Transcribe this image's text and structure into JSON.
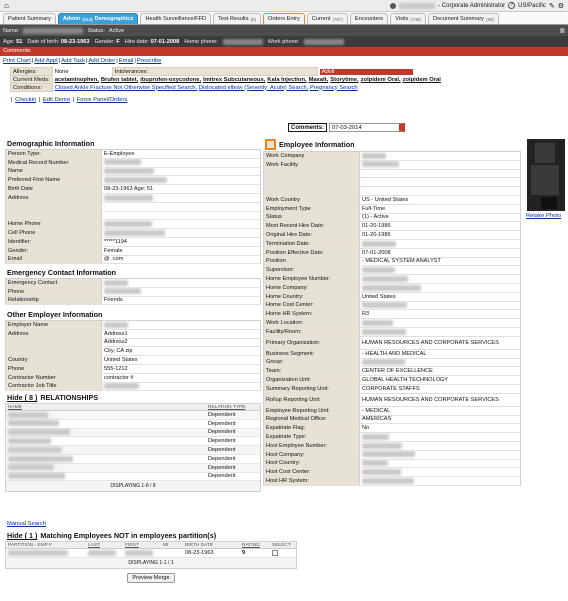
{
  "topbar": {
    "home_icon": "home-icon",
    "user_role": "- Corporate Administrator",
    "help_icon": "help-icon",
    "timezone": "US/Pacific",
    "edit_icon": "pencil-icon",
    "settings_icon": "gear-icon"
  },
  "tabs": [
    {
      "label": "Patient Summary",
      "count": ""
    },
    {
      "label": "Admin",
      "count": "(113)",
      "suffix": "Demographics"
    },
    {
      "label": "Health Surveillance/FFD",
      "count": ""
    },
    {
      "label": "Test Results",
      "count": "(6)"
    },
    {
      "label": "Orders Entry",
      "count": ""
    },
    {
      "label": "Current",
      "count": "(787)"
    },
    {
      "label": "Encounters",
      "count": ""
    },
    {
      "label": "Visits",
      "count": "(748)"
    },
    {
      "label": "Document Summary",
      "count": "(89)"
    }
  ],
  "patient": {
    "name_label": "Name:",
    "status_label": "Status:",
    "status": "Active",
    "age_label": "Age:",
    "age": "51",
    "dob_label": "Date of birth:",
    "dob": "08-23-1963",
    "gender_label": "Gender:",
    "gender": "F",
    "hire_label": "Hire date:",
    "hire_date": "07-01-2008",
    "home_phone_label": "Home phone:",
    "work_phone_label": "Work phone:"
  },
  "comments_bar": "Comments:",
  "actions": [
    "Print Chart",
    "Add Appt",
    "Add Task",
    "Add Order",
    "Email",
    "Prescribe"
  ],
  "clinical": {
    "allergies_label": "Allergies:",
    "allergies_value": "None",
    "intolerances_label": "Intolerances:",
    "intolerance_value": "Advil",
    "meds_label": "Current Meds:",
    "meds": [
      "acetaminophen,",
      "Brufen tablet,",
      "ibuprofen-oxycodone,",
      "Imitrex Subcutaneous,",
      "Kala Injection,",
      "Maxalt,",
      "Storytime,",
      "zolpidem Oral,",
      "zolpidem Oral"
    ],
    "conditions_label": "Conditions:",
    "conditions": [
      "Closed Ankle Fracture Not Otherwise Specified Search,",
      "Dislocated elbow (Severity: Acute) Search,",
      "Pregnancy Search"
    ]
  },
  "links2": [
    "Checkin",
    "Edit Demo",
    "Force Panel/Orders"
  ],
  "comments_box": {
    "label": "Comments:",
    "value": "07-03-2014"
  },
  "demographic": {
    "title": "Demographic Information",
    "rows": [
      {
        "k": "Person Type:",
        "v": "E-Employee"
      },
      {
        "k": "Medical Record Number",
        "v": ""
      },
      {
        "k": "Name",
        "v": ""
      },
      {
        "k": "Preferred First Name",
        "v": ""
      },
      {
        "k": "Birth Date",
        "v": "08-23-1963 Age: 51"
      },
      {
        "k": "Address",
        "v": ""
      },
      {
        "k": "",
        "v": ""
      },
      {
        "k": "",
        "v": ""
      },
      {
        "k": "Home Phone",
        "v": ""
      },
      {
        "k": "Cell Phone",
        "v": ""
      },
      {
        "k": "Identifier:",
        "v": "*****1194"
      },
      {
        "k": "Gender:",
        "v": "Female"
      },
      {
        "k": "Email",
        "v": "@ .com"
      }
    ]
  },
  "emergency": {
    "title": "Emergency Contact Information",
    "rows": [
      {
        "k": "Emergency Contact",
        "v": ""
      },
      {
        "k": "Phone",
        "v": ""
      },
      {
        "k": "Relationship",
        "v": "Friends"
      }
    ]
  },
  "other_employer": {
    "title": "Other Employer Information",
    "rows": [
      {
        "k": "Employer Name",
        "v": ""
      },
      {
        "k": "Address",
        "v": "Address1"
      },
      {
        "k": "",
        "v": "Address2"
      },
      {
        "k": "",
        "v": "City, CA zip"
      },
      {
        "k": "Country",
        "v": "United States"
      },
      {
        "k": "Phone",
        "v": "555-1212"
      },
      {
        "k": "Contractor Number",
        "v": "contractor #"
      },
      {
        "k": "Contractor Job Title",
        "v": ""
      }
    ]
  },
  "relationships": {
    "hide_label": "Hide ( 8 )",
    "title": "RELATIONSHIPS",
    "col_name": "NAME",
    "col_type": "RELATION TYPE",
    "rows": [
      "Dependent",
      "Dependent",
      "Dependent",
      "Dependent",
      "Dependent",
      "Dependent",
      "Dependent",
      "Dependent"
    ],
    "footer": "DISPLAYING 1-8 / 8"
  },
  "manual_search": "Manual Search",
  "matching": {
    "hide_label": "Hide ( 1 )",
    "title": "Matching Employees NOT in employees partition(s)",
    "cols": [
      "PARTITION - EMP #",
      "LAST",
      "FIRST",
      "MI",
      "BIRTH DATE",
      "RATING",
      "SELECT"
    ],
    "row": {
      "birth": "08-23-1963",
      "rating": "9"
    },
    "footer": "DISPLAYING 1-1 / 1",
    "preview_button": "Preview Merge"
  },
  "employee": {
    "title": "Employee Information",
    "rows": [
      {
        "k": "Work Company",
        "v": ""
      },
      {
        "k": "Work Facility",
        "v": ""
      },
      {
        "k": "",
        "v": ""
      },
      {
        "k": "",
        "v": ""
      },
      {
        "k": "",
        "v": ""
      },
      {
        "k": "Work Country",
        "v": "US - United States"
      },
      {
        "k": "Employment Type",
        "v": "Full-Time"
      },
      {
        "k": "Status",
        "v": "(1) - Active"
      },
      {
        "k": "Most Recent Hire Date:",
        "v": "01-20-1986"
      },
      {
        "k": "Original Hire Date:",
        "v": "01-20-1986"
      },
      {
        "k": "Termination Date:",
        "v": ""
      },
      {
        "k": "Position Effective Date:",
        "v": "07-01-2008"
      },
      {
        "k": "Position",
        "v": "- MEDICAL SYSTEM ANALYST"
      },
      {
        "k": "Supervisor:",
        "v": ""
      },
      {
        "k": "Home Employee Number:",
        "v": ""
      },
      {
        "k": "Home Company:",
        "v": ""
      },
      {
        "k": "Home Country:",
        "v": "United States"
      },
      {
        "k": "Home Cost Center:",
        "v": ""
      },
      {
        "k": "Home HR System:",
        "v": "R3"
      },
      {
        "k": "Work Location:",
        "v": ""
      },
      {
        "k": "Facility/Room:",
        "v": ""
      },
      {
        "k": "Primary Organization:",
        "v": "HUMAN RESOURCES AND CORPORATE SERVICES"
      },
      {
        "k": "Business Segment:",
        "v": "- HEALTH AND MEDICAL"
      },
      {
        "k": "Group:",
        "v": ""
      },
      {
        "k": "Team:",
        "v": "CENTER OF EXCELLENCE"
      },
      {
        "k": "Organization Unit:",
        "v": "GLOBAL HEALTH TECHNOLOGY"
      },
      {
        "k": "Summary Reporting Unit:",
        "v": "CORPORATE STAFFS"
      },
      {
        "k": "Rollup Reporting Unit:",
        "v": "HUMAN RESOURCES AND CORPORATE SERVICES"
      },
      {
        "k": "Employee Reporting Unit:",
        "v": "- MEDICAL"
      },
      {
        "k": "Regional Medical Office:",
        "v": "AMERICAS"
      },
      {
        "k": "Expatriate Flag:",
        "v": "No"
      },
      {
        "k": "Expatriate Type:",
        "v": ""
      },
      {
        "k": "Host Employee Number:",
        "v": ""
      },
      {
        "k": "Host Company:",
        "v": ""
      },
      {
        "k": "Host Country:",
        "v": ""
      },
      {
        "k": "Host Cost Center:",
        "v": ""
      },
      {
        "k": "Host HR System:",
        "v": ""
      }
    ]
  },
  "photo": {
    "retake_label": "Retake Photo"
  }
}
